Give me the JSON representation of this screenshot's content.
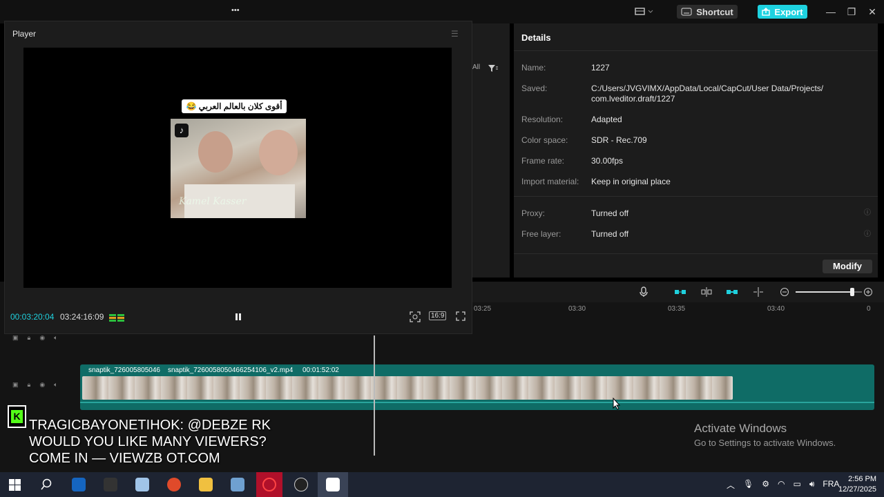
{
  "topbar": {
    "more_label": "•••",
    "shortcut_label": "Shortcut",
    "export_label": "Export"
  },
  "player": {
    "title": "Player",
    "caption": "أقوى كلان بالعالم العربي 😂",
    "watermark": "Kamel Kasser",
    "time_current": "00:03:20:04",
    "time_total": "03:24:16:09",
    "ratio": "16:9"
  },
  "midpanel": {
    "filter_all": "All"
  },
  "details": {
    "title": "Details",
    "rows": [
      {
        "label": "Name:",
        "value": "1227"
      },
      {
        "label": "Saved:",
        "value": "C:/Users/JVGVIMX/AppData/Local/CapCut/User Data/Projects/ com.lveditor.draft/1227"
      },
      {
        "label": "Resolution:",
        "value": "Adapted"
      },
      {
        "label": "Color space:",
        "value": "SDR - Rec.709"
      },
      {
        "label": "Frame rate:",
        "value": "30.00fps"
      },
      {
        "label": "Import material:",
        "value": "Keep in original place"
      },
      {
        "label": "Proxy:",
        "value": "Turned off"
      },
      {
        "label": "Free layer:",
        "value": "Turned off"
      }
    ],
    "modify_label": "Modify"
  },
  "timeline": {
    "ruler": [
      "03:25",
      "03:30",
      "03:35",
      "03:40",
      "0"
    ],
    "clip1_label": "snaptik_726005805046",
    "clip2_label": "snaptik_7260058050466254106_v2.mp4",
    "clip2_duration": "00:01:52:02",
    "zoom_level": 0.85
  },
  "overlay": {
    "stream_text": "TRAGICBAYONETIHOK: @DEBZE RK WOULD YOU LIKE MANY VIEWERS? COME IN — VIEWZB OT.COM",
    "activate_title": "Activate Windows",
    "activate_sub": "Go to Settings to activate Windows."
  },
  "taskbar": {
    "lang": "FRA",
    "time": "2:56 PM",
    "date": "12/27/2025"
  },
  "colors": {
    "accent": "#1ed2e0",
    "track": "#0f6c66",
    "panel": "#1c1c1c"
  }
}
